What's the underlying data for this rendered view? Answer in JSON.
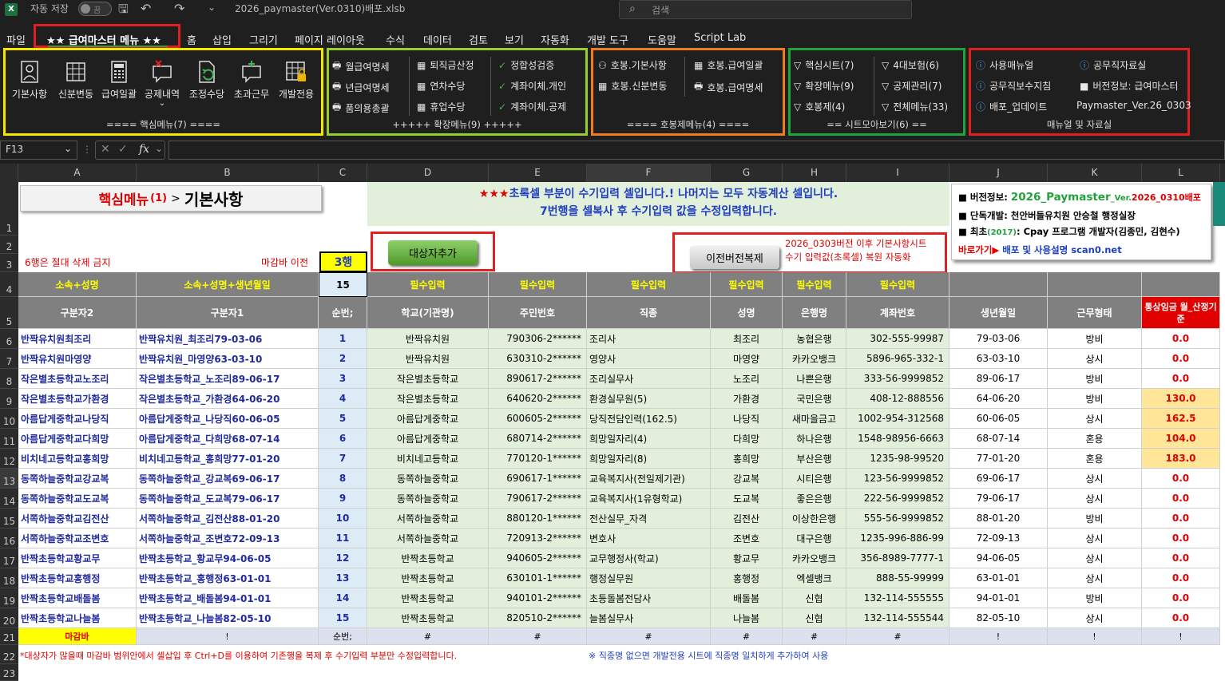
{
  "titlebar": {
    "autosave_label": "자동 저장",
    "autosave_state": "끔",
    "filename": "2026_paymaster(Ver.0310)배포.xlsb",
    "search_placeholder": "검색"
  },
  "menu": [
    "파일",
    "★★ 급여마스터 메뉴 ★★",
    "홈",
    "삽입",
    "그리기",
    "페이지 레이아웃",
    "수식",
    "데이터",
    "검토",
    "보기",
    "자동화",
    "개발 도구",
    "도움말",
    "Script Lab"
  ],
  "ribbon": {
    "core": {
      "buttons": [
        "기본사항",
        "신분변동",
        "급여일괄",
        "공제내역",
        "조정수당",
        "초과근무",
        "개발전용"
      ],
      "title": "==== 핵심메뉴(7) ===="
    },
    "ext": {
      "col1": [
        "월급여명세",
        "년급여명세",
        "품의용총괄"
      ],
      "col2": [
        "퇴직금산정",
        "연차수당",
        "휴업수당"
      ],
      "col3": [
        "정합성검증",
        "계좌이체.개인",
        "계좌이체.공제"
      ],
      "title": "+++++ 확장메뉴(9) +++++"
    },
    "hobong": {
      "col1": [
        "호봉.기본사항",
        "호봉.신분변동"
      ],
      "col2": [
        "호봉.급여일괄",
        "호봉.급여명세"
      ],
      "title": "==== 호봉제메뉴(4) ===="
    },
    "sheets": {
      "col1": [
        "핵심시트(7)",
        "확장메뉴(9)",
        "호봉제(4)"
      ],
      "col2": [
        "4대보험(6)",
        "공제관리(7)",
        "전체메뉴(33)"
      ],
      "title": "== 시트모아보기(6) =="
    },
    "manual": {
      "col1": [
        "사용매뉴얼",
        "공무직보수지침",
        "배포_업데이트"
      ],
      "col2": [
        "공무직자료실",
        "버전정보: 급여마스터",
        "Paymaster_Ver.26_0303"
      ],
      "title": "매뉴얼 및 자료실"
    }
  },
  "formula": {
    "namebox": "F13",
    "fx": "fx",
    "value": ""
  },
  "columns": [
    "A",
    "B",
    "C",
    "D",
    "E",
    "F",
    "G",
    "H",
    "I",
    "J",
    "K",
    "L"
  ],
  "rows": [
    "1",
    "2",
    "3",
    "4",
    "5",
    "6",
    "7",
    "8",
    "9",
    "10",
    "11",
    "12",
    "13",
    "14",
    "15",
    "16",
    "17",
    "18",
    "19",
    "20",
    "21",
    "22",
    "23"
  ],
  "sheet": {
    "title_red": "핵심메뉴",
    "title_num": "(1)",
    "title_arrow": ">",
    "title_main": "기본사항",
    "notice_line1_stars": "★★★",
    "notice_line1": "초록셀 부분이 수기입력 셀입니다.! 나머지는 모두 자동계산 셀입니다.",
    "notice_line2": "7번행을 셀복사 후 수기입력 값을 수정입력합니다.",
    "info": {
      "line1_prefix": "■ 버전정보: ",
      "line1_ver": "2026_Paymaster",
      "line1_suffix": "_Ver.",
      "line1_date": "2026_0310배포",
      "line2": "■ 단독개발: 천안버들유치원 안승철 행정실장",
      "line3_prefix": "■ 최초",
      "line3_year": "(2017)",
      "line3_rest": ": Cpay 프로그램 개발자(김종민, 김현수)",
      "line4_red": "바로가기▶",
      "line4_blue": "배포 및 사용설명 scan0.net"
    },
    "add_button": "대상자추가",
    "restore_button": "이전버전복제",
    "restore_note1": "2026_0303버전 이후 기본사항시트",
    "restore_note2": "수기 입력값(초록셀) 복원 자동화",
    "warn_row6": "6행은 절대 삭제 금지",
    "deadline_label": "마감바 이전",
    "deadline_value": "3행",
    "count_value": "15",
    "row4": [
      "소속+성명",
      "소속+성명+생년월일",
      "",
      "필수입력",
      "필수입력",
      "필수입력",
      "필수입력",
      "필수입력",
      "필수입력"
    ],
    "headers": [
      "구분자2",
      "구분자1",
      "순번;",
      "학교(기관명)",
      "주민번호",
      "직종",
      "성명",
      "은행명",
      "계좌번호",
      "생년월일",
      "근무형태",
      "통상임금 월_산정기준"
    ],
    "data": [
      [
        "반짝유치원최조리",
        "반짝유치원_최조리79-03-06",
        "1",
        "반짝유치원",
        "790306-2******",
        "조리사",
        "최조리",
        "농협은행",
        "302-555-99987",
        "79-03-06",
        "방비",
        "0.0"
      ],
      [
        "반짝유치원마영양",
        "반짝유치원_마영양63-03-10",
        "2",
        "반짝유치원",
        "630310-2******",
        "영양사",
        "마영양",
        "카카오뱅크",
        "5896-965-332-1",
        "63-03-10",
        "상시",
        "0.0"
      ],
      [
        "작은별초등학교노조리",
        "작은별초등학교_노조리89-06-17",
        "3",
        "작은별초등학교",
        "890617-2******",
        "조리실무사",
        "노조리",
        "나쁜은행",
        "333-56-9999852",
        "89-06-17",
        "방비",
        "0.0"
      ],
      [
        "작은별초등학교가환경",
        "작은별초등학교_가환경64-06-20",
        "4",
        "작은별초등학교",
        "640620-2******",
        "환경실무원(5)",
        "가환경",
        "국민은행",
        "408-12-888556",
        "64-06-20",
        "방비",
        "130.0"
      ],
      [
        "아름답게중학교나당직",
        "아름답게중학교_나당직60-06-05",
        "5",
        "아름답게중학교",
        "600605-2******",
        "당직전담인력(162.5)",
        "나당직",
        "새마을금고",
        "1002-954-312568",
        "60-06-05",
        "상시",
        "162.5"
      ],
      [
        "아름답게중학교다희망",
        "아름답게중학교_다희망68-07-14",
        "6",
        "아름답게중학교",
        "680714-2******",
        "희망일자리(4)",
        "다희망",
        "하나은행",
        "1548-98956-6663",
        "68-07-14",
        "혼용",
        "104.0"
      ],
      [
        "비치네고등학교홍희망",
        "비치네고등학교_홍희망77-01-20",
        "7",
        "비치네고등학교",
        "770120-1******",
        "희망일자리(8)",
        "홍희망",
        "부산은행",
        "1235-98-99520",
        "77-01-20",
        "혼용",
        "183.0"
      ],
      [
        "동쪽하늘중학교강교복",
        "동쪽하늘중학교_강교복69-06-17",
        "8",
        "동쪽하늘중학교",
        "690617-1******",
        "교육복지사(전일제기관)",
        "강교복",
        "시티은행",
        "123-56-9999852",
        "69-06-17",
        "상시",
        "0.0"
      ],
      [
        "동쪽하늘중학교도교복",
        "동쪽하늘중학교_도교복79-06-17",
        "9",
        "동쪽하늘중학교",
        "790617-2******",
        "교육복지사(1유형학교)",
        "도교복",
        "좋은은행",
        "222-56-9999852",
        "79-06-17",
        "상시",
        "0.0"
      ],
      [
        "서쪽하늘중학교김전산",
        "서쪽하늘중학교_김전산88-01-20",
        "10",
        "서쪽하늘중학교",
        "880120-1******",
        "전산실무_자격",
        "김전산",
        "이상한은행",
        "555-56-9999852",
        "88-01-20",
        "방비",
        "0.0"
      ],
      [
        "서쪽하늘중학교조변호",
        "서쪽하늘중학교_조변호72-09-13",
        "11",
        "서쪽하늘중학교",
        "720913-2******",
        "변호사",
        "조변호",
        "대구은행",
        "1235-996-886-99",
        "72-09-13",
        "상시",
        "0.0"
      ],
      [
        "반짝초등학교황교무",
        "반짝초등학교_황교무94-06-05",
        "12",
        "반짝초등학교",
        "940605-2******",
        "교무행정사(학교)",
        "황교무",
        "카카오뱅크",
        "356-8989-7777-1",
        "94-06-05",
        "상시",
        "0.0"
      ],
      [
        "반짝초등학교홍행정",
        "반짝초등학교_홍행정63-01-01",
        "13",
        "반짝초등학교",
        "630101-1******",
        "행정실무원",
        "홍행정",
        "엑셀뱅크",
        "888-55-99999",
        "63-01-01",
        "상시",
        "0.0"
      ],
      [
        "반짝초등학교배돌봄",
        "반짝초등학교_배돌봄94-01-01",
        "14",
        "반짝초등학교",
        "940101-2******",
        "초등돌봄전담사",
        "배돌봄",
        "신협",
        "132-114-555555",
        "94-01-01",
        "방비",
        "0.0"
      ],
      [
        "반짝초등학교나늘봄",
        "반짝초등학교_나늘봄82-05-10",
        "15",
        "반짝초등학교",
        "820510-2******",
        "늘봄실무사",
        "나늘봄",
        "신협",
        "132-114-555544",
        "82-05-10",
        "상시",
        "0.0"
      ]
    ],
    "row21": [
      "마감바",
      "!",
      "순번;",
      "#",
      "#",
      "#",
      "#",
      "#",
      "#",
      "!",
      "!",
      "!"
    ],
    "note_row22_left": "*대상자가 많을때 마감바 범위안에서 셀삽입 후 Ctrl+D를 이용하여 기존행을 복제 후 수기입력 부분만 수정입력합니다.",
    "note_row22_right": "※ 직종명 없으면 개발전용 시트에 직종명 일치하게 추가하여 사용"
  },
  "colors": {
    "yellow_box": "#f5e600",
    "lime_box": "#9acd32",
    "orange_box": "#f07c1e",
    "green_box": "#1fa33a",
    "red_box": "#e02020",
    "header_fill": "#808080",
    "green_fill": "#e2efda",
    "yellow_fill": "#ffe699"
  }
}
